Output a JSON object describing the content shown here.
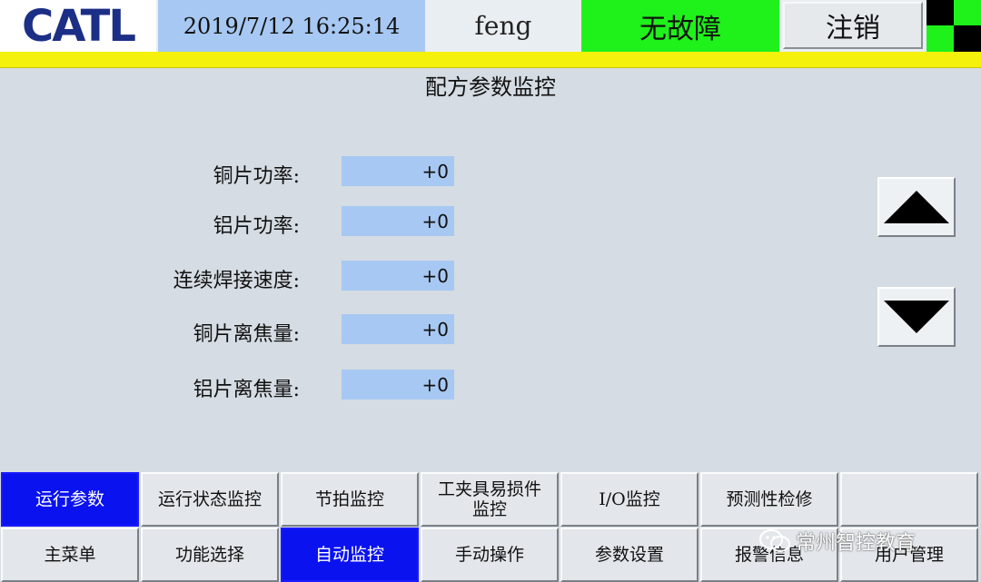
{
  "header": {
    "logo": "CATL",
    "datetime": "2019/7/12 16:25:14",
    "user": "feng",
    "status": "无故障",
    "logout_label": "注销"
  },
  "main": {
    "title": "配方参数监控",
    "params": [
      {
        "label": "铜片功率:",
        "value": "+0"
      },
      {
        "label": "铝片功率:",
        "value": "+0"
      },
      {
        "label": "连续焊接速度:",
        "value": "+0"
      },
      {
        "label": "铜片离焦量:",
        "value": "+0"
      },
      {
        "label": "铝片离焦量:",
        "value": "+0"
      }
    ]
  },
  "nav_top": [
    {
      "label": "运行参数",
      "active": true
    },
    {
      "label": "运行状态监控",
      "active": false
    },
    {
      "label": "节拍监控",
      "active": false
    },
    {
      "label": "工夹具易损件\n监控",
      "active": false
    },
    {
      "label": "I/O监控",
      "active": false
    },
    {
      "label": "预测性检修",
      "active": false
    },
    {
      "label": "",
      "active": false
    }
  ],
  "nav_bottom": [
    {
      "label": "主菜单",
      "active": false
    },
    {
      "label": "功能选择",
      "active": false
    },
    {
      "label": "自动监控",
      "active": true
    },
    {
      "label": "手动操作",
      "active": false
    },
    {
      "label": "参数设置",
      "active": false
    },
    {
      "label": "报警信息",
      "active": false
    },
    {
      "label": "用户管理",
      "active": false
    }
  ],
  "watermark": "常州智控教育",
  "colors": {
    "status_ok": "#1ff21a",
    "active_nav": "#0a12f0",
    "value_field": "#a7c8f2",
    "alarm_bar": "#f4f10c",
    "logo": "#1c2f86"
  }
}
